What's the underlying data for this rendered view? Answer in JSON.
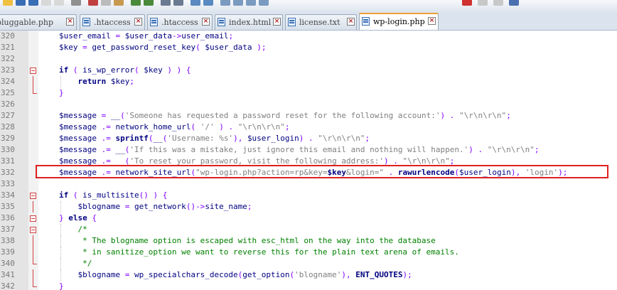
{
  "toolbar": {
    "icons": [
      "open-icon",
      "save-icon",
      "save-all-icon",
      "close-icon",
      "close-all-icon",
      "print-icon",
      "cut-icon",
      "copy-icon",
      "paste-icon",
      "undo-icon",
      "redo-icon",
      "find-icon",
      "replace-icon",
      "zoom-in-icon",
      "zoom-out-icon",
      "sync-scroll-icon",
      "word-wrap-icon",
      "indent-guide-icon",
      "show-all-icon",
      "record-macro-icon",
      "stop-macro-icon",
      "play-macro-icon",
      "save-macro-icon"
    ]
  },
  "tabs": [
    {
      "label": "pluggable.php",
      "active": false
    },
    {
      "label": ".htaccess",
      "active": false
    },
    {
      "label": ".htaccess",
      "active": false
    },
    {
      "label": "index.html",
      "active": false
    },
    {
      "label": "license.txt",
      "active": false
    },
    {
      "label": "wp-login.php",
      "active": true
    }
  ],
  "editor": {
    "highlighted_line": 332,
    "lines": [
      {
        "n": "320",
        "text": "$user_email = $user_data->user_email;"
      },
      {
        "n": "321",
        "text": "$key = get_password_reset_key( $user_data );"
      },
      {
        "n": "322",
        "text": ""
      },
      {
        "n": "323",
        "text": "if ( is_wp_error( $key ) ) {"
      },
      {
        "n": "324",
        "text": "return $key;"
      },
      {
        "n": "325",
        "text": "}"
      },
      {
        "n": "326",
        "text": ""
      },
      {
        "n": "327",
        "text": "$message = __('Someone has requested a password reset for the following account:') . \"\\r\\n\\r\\n\";"
      },
      {
        "n": "328",
        "text": "$message .= network_home_url( '/' ) . \"\\r\\n\\r\\n\";"
      },
      {
        "n": "329",
        "text": "$message .= sprintf(__('Username: %s'), $user_login) . \"\\r\\n\\r\\n\";"
      },
      {
        "n": "330",
        "text": "$message .= __('If this was a mistake, just ignore this email and nothing will happen.') . \"\\r\\n\\r\\n\";"
      },
      {
        "n": "331",
        "text": "$message .= __('To reset your password, visit the following address:') . \"\\r\\n\\r\\n\";"
      },
      {
        "n": "332",
        "text": "$message .= network_site_url(\"wp-login.php?action=rp&key=$key&login=\" . rawurlencode($user_login), 'login');"
      },
      {
        "n": "333",
        "text": ""
      },
      {
        "n": "334",
        "text": "if ( is_multisite() ) {"
      },
      {
        "n": "335",
        "text": "$blogname = get_network()->site_name;"
      },
      {
        "n": "336",
        "text": "} else {"
      },
      {
        "n": "337",
        "text": "/*"
      },
      {
        "n": "338",
        "text": "* The blogname option is escaped with esc_html on the way into the database"
      },
      {
        "n": "339",
        "text": "* in sanitize_option we want to reverse this for the plain text arena of emails."
      },
      {
        "n": "340",
        "text": "*/"
      },
      {
        "n": "341",
        "text": "$blogname = wp_specialchars_decode(get_option('blogname'), ENT_QUOTES);"
      },
      {
        "n": "342",
        "text": "}"
      }
    ]
  }
}
